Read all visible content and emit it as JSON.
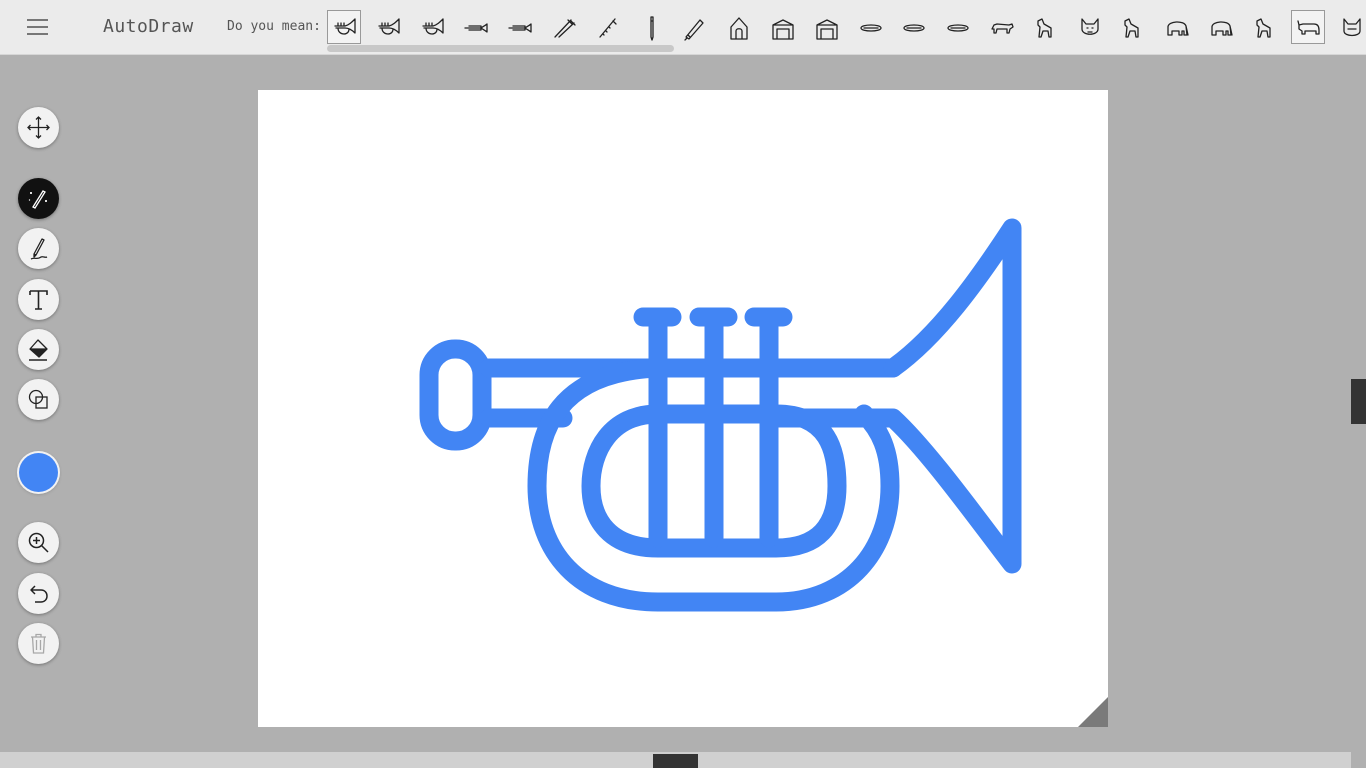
{
  "header": {
    "title": "AutoDraw",
    "suggest_label": "Do you mean:",
    "menu_icon": "hamburger-icon"
  },
  "suggestions": [
    {
      "name": "trumpet",
      "selected": true
    },
    {
      "name": "trumpet",
      "selected": false
    },
    {
      "name": "trumpet",
      "selected": false
    },
    {
      "name": "trombone",
      "selected": false
    },
    {
      "name": "trombone",
      "selected": false
    },
    {
      "name": "toothbrushes",
      "selected": false
    },
    {
      "name": "flute",
      "selected": false
    },
    {
      "name": "pencil",
      "selected": false
    },
    {
      "name": "pen",
      "selected": false
    },
    {
      "name": "birdhouse",
      "selected": false
    },
    {
      "name": "doghouse",
      "selected": false
    },
    {
      "name": "doghouse",
      "selected": false
    },
    {
      "name": "hotdog",
      "selected": false
    },
    {
      "name": "hotdog",
      "selected": false
    },
    {
      "name": "hotdog",
      "selected": false
    },
    {
      "name": "dachshund",
      "selected": false
    },
    {
      "name": "dog",
      "selected": false
    },
    {
      "name": "bulldog",
      "selected": false
    },
    {
      "name": "dog",
      "selected": false
    },
    {
      "name": "elephant",
      "selected": false
    },
    {
      "name": "elephant",
      "selected": false
    },
    {
      "name": "dog",
      "selected": false
    },
    {
      "name": "rhinoceros",
      "selected": true
    },
    {
      "name": "cat",
      "selected": false
    }
  ],
  "tools": [
    {
      "name": "move-tool",
      "icon": "move-icon",
      "active": false,
      "disabled": false
    },
    {
      "name": "autodraw-tool",
      "icon": "autodraw-icon",
      "active": true,
      "disabled": false
    },
    {
      "name": "draw-tool",
      "icon": "pencil-icon",
      "active": false,
      "disabled": false
    },
    {
      "name": "type-tool",
      "icon": "text-icon",
      "active": false,
      "disabled": false
    },
    {
      "name": "fill-tool",
      "icon": "fill-icon",
      "active": false,
      "disabled": false
    },
    {
      "name": "shape-tool",
      "icon": "shapes-icon",
      "active": false,
      "disabled": false
    },
    {
      "name": "zoom-tool",
      "icon": "zoom-in-icon",
      "active": false,
      "disabled": false
    },
    {
      "name": "undo-tool",
      "icon": "undo-icon",
      "active": false,
      "disabled": false
    },
    {
      "name": "delete-tool",
      "icon": "trash-icon",
      "active": false,
      "disabled": true
    }
  ],
  "colors": {
    "current": "#4285F4",
    "drawing_stroke": "#4285F4",
    "canvas_bg": "#ffffff",
    "workspace_bg": "#b0b0b0"
  },
  "canvas": {
    "drawing": "trumpet"
  }
}
